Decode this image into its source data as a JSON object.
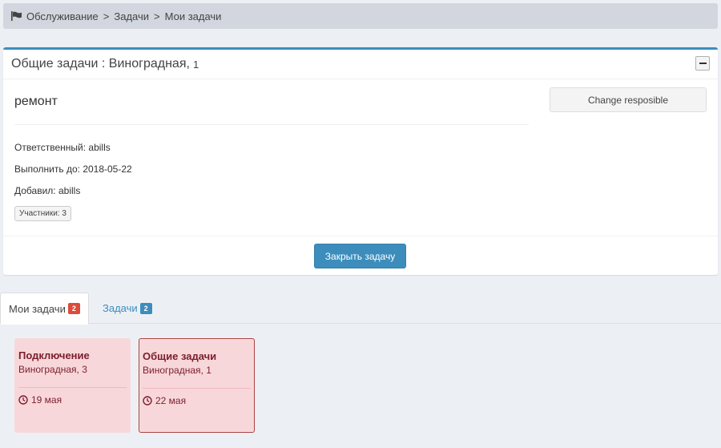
{
  "breadcrumb": {
    "icon": "flag-icon",
    "items": [
      "Обслуживание",
      "Задачи",
      "Мои задачи"
    ],
    "separator": ">"
  },
  "panel": {
    "header_title": "Общие задачи : Виноградная,",
    "header_number": "1",
    "collapse_icon": "minus-icon",
    "task_title": "ремонт",
    "change_button": "Change resposible",
    "responsible_label": "Ответственный:",
    "responsible_value": "abills",
    "due_label": "Выполнить до:",
    "due_value": "2018-05-22",
    "added_label": "Добавил:",
    "added_value": "abills",
    "members_badge": "Участники: 3",
    "close_button": "Закрыть задачу",
    "accent_color": "#3c8dbc"
  },
  "tabs": [
    {
      "label": "Мои задачи",
      "count": "2",
      "badge_color": "#dd4b39",
      "active": true
    },
    {
      "label": "Задачи",
      "count": "2",
      "badge_color": "#3c8dbc",
      "active": false
    }
  ],
  "cards": [
    {
      "title": "Подключение",
      "address": "Виноградная, 3",
      "date": "19 мая",
      "icon": "clock-icon",
      "selected": false
    },
    {
      "title": "Общие задачи",
      "address": "Виноградная, 1",
      "date": "22 мая",
      "icon": "clock-icon",
      "selected": true
    }
  ]
}
